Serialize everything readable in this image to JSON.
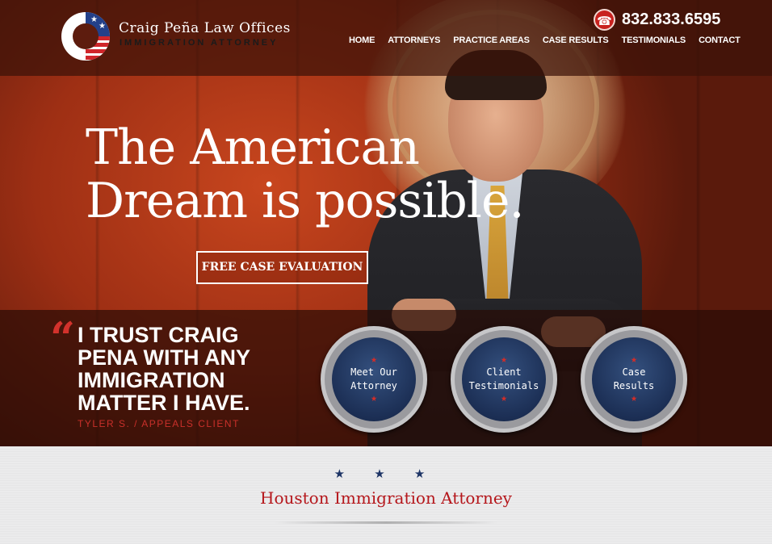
{
  "brand": {
    "name": "Craig Peña Law Offices",
    "subtitle": "IMMIGRATION ATTORNEY"
  },
  "header": {
    "phone": "832.833.6595",
    "nav": [
      "HOME",
      "ATTORNEYS",
      "PRACTICE AREAS",
      "CASE RESULTS",
      "TESTIMONIALS",
      "CONTACT"
    ]
  },
  "hero": {
    "headline_line1": "The American",
    "headline_line2": "Dream is possible.",
    "cta": "FREE CASE EVALUATION"
  },
  "testimonial": {
    "quote_mark": "“",
    "quote": "I TRUST CRAIG PENA WITH ANY IMMIGRATION MATTER I HAVE.",
    "author": "TYLER S. / APPEALS CLIENT"
  },
  "circles": [
    {
      "line1": "Meet Our",
      "line2": "Attorney"
    },
    {
      "line1": "Client",
      "line2": "Testimonials"
    },
    {
      "line1": "Case",
      "line2": "Results"
    }
  ],
  "section": {
    "stars": "★ ★ ★",
    "title": "Houston Immigration Attorney"
  },
  "colors": {
    "accent_red": "#c8221f",
    "navy": "#1e3566",
    "title_red": "#b5161b"
  }
}
